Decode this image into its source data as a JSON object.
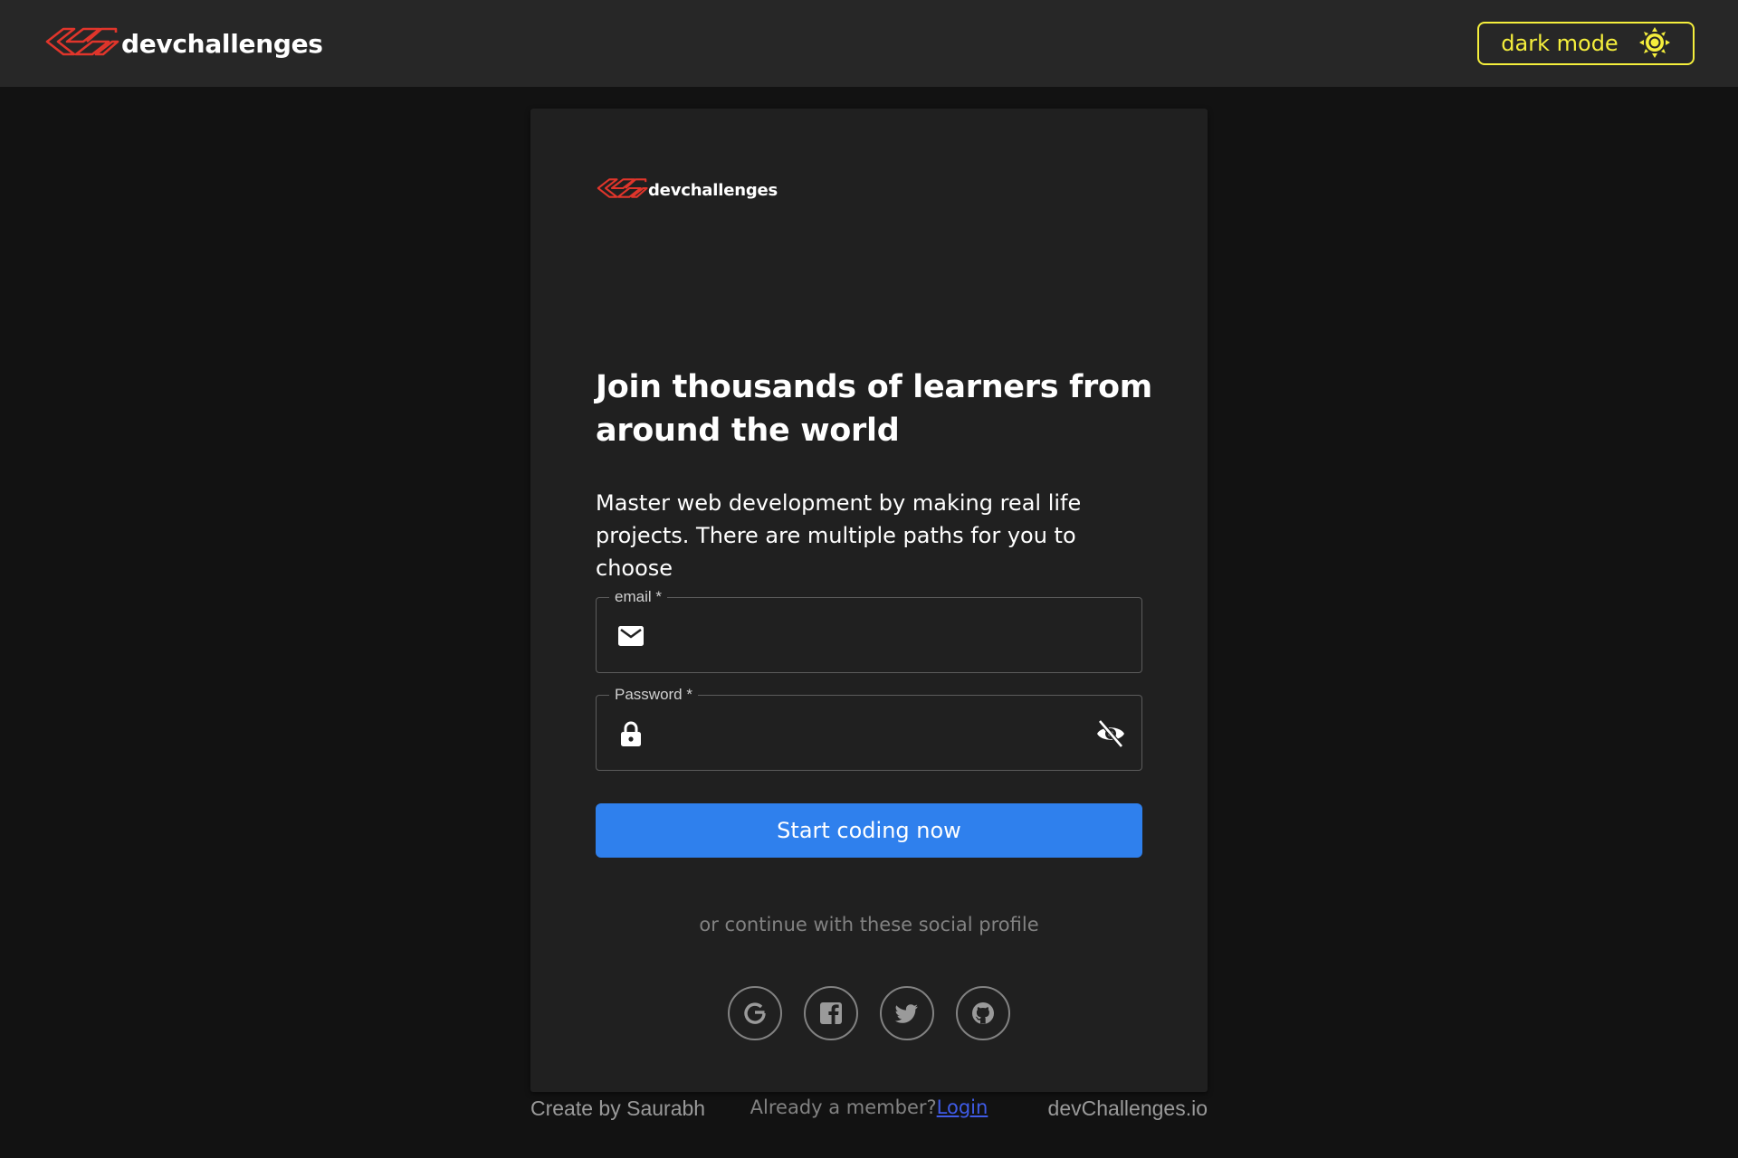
{
  "header": {
    "brand_name": "devchallenges",
    "logo_icon": "devchallenges-logo-icon",
    "mode_toggle_label": "dark mode",
    "mode_icon": "sun-icon"
  },
  "card": {
    "brand_name": "devchallenges",
    "heading": "Join thousands of learners from around the world",
    "subtext": "Master web development by making real life projects. There are multiple paths for you to choose",
    "email_field": {
      "label": "email *",
      "value": "",
      "icon": "mail-icon"
    },
    "password_field": {
      "label": "Password *",
      "value": "",
      "icon": "lock-icon",
      "toggle_icon": "eye-off-icon"
    },
    "submit_label": "Start coding now",
    "social_caption": "or continue with these social profile",
    "social_buttons": [
      "google-icon",
      "facebook-icon",
      "twitter-icon",
      "github-icon"
    ],
    "member_prompt": "Already a member?",
    "login_link": "Login"
  },
  "footer": {
    "left_text": "Create by Saurabh",
    "right_text": "devChallenges.io"
  },
  "colors": {
    "page_bg": "#121212",
    "header_bg": "#272727",
    "card_bg": "#202020",
    "accent_yellow": "#f5ef3c",
    "primary_blue": "#2f80ed",
    "logo_red": "#e0352b",
    "muted_text": "#828282",
    "link_blue": "#3f5be6"
  }
}
